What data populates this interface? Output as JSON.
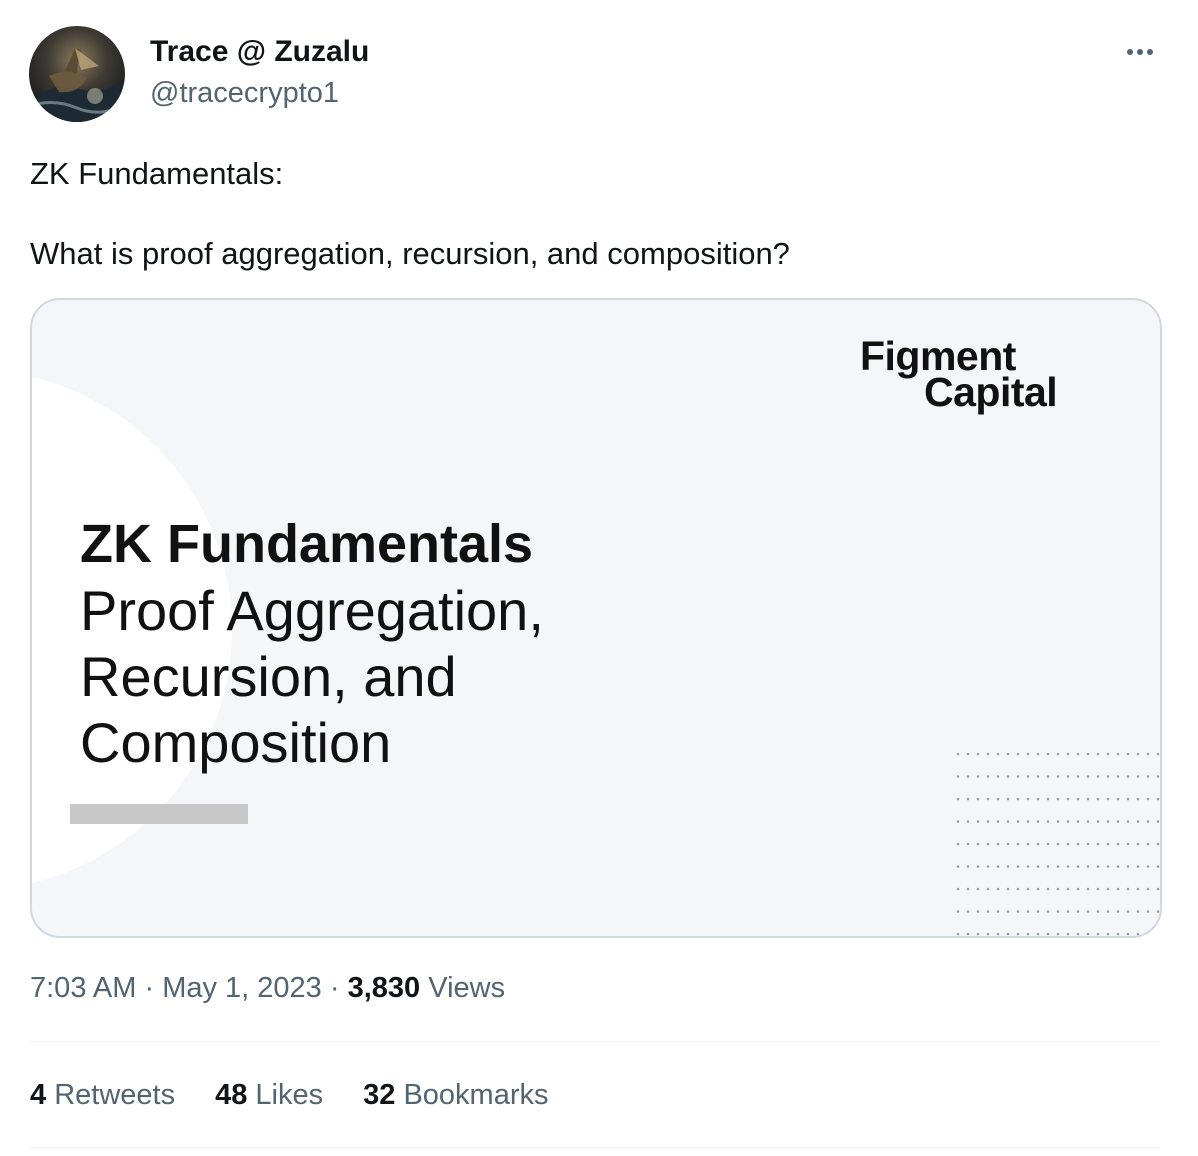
{
  "author": {
    "display_name": "Trace @ Zuzalu",
    "handle": "@tracecrypto1",
    "avatar_icon": "avatar-image"
  },
  "more_icon": "more-horizontal-icon",
  "tweet": {
    "line1": "ZK Fundamentals:",
    "line2": "What is proof aggregation, recursion, and composition?"
  },
  "card": {
    "logo_line1": "Figment",
    "logo_line2": "Capital",
    "title": "ZK Fundamentals",
    "subtitle_lines": [
      "Proof Aggregation,",
      "Recursion, and",
      "Composition"
    ]
  },
  "meta": {
    "time": "7:03 AM",
    "separator": "·",
    "date": "May 1, 2023",
    "views_count": "3,830",
    "views_label": "Views"
  },
  "stats": {
    "retweets_count": "4",
    "retweets_label": "Retweets",
    "likes_count": "48",
    "likes_label": "Likes",
    "bookmarks_count": "32",
    "bookmarks_label": "Bookmarks"
  },
  "colors": {
    "text_primary": "#0f1419",
    "text_secondary": "#536471",
    "card_background": "#f5f6fa",
    "border": "#cfd9de"
  }
}
